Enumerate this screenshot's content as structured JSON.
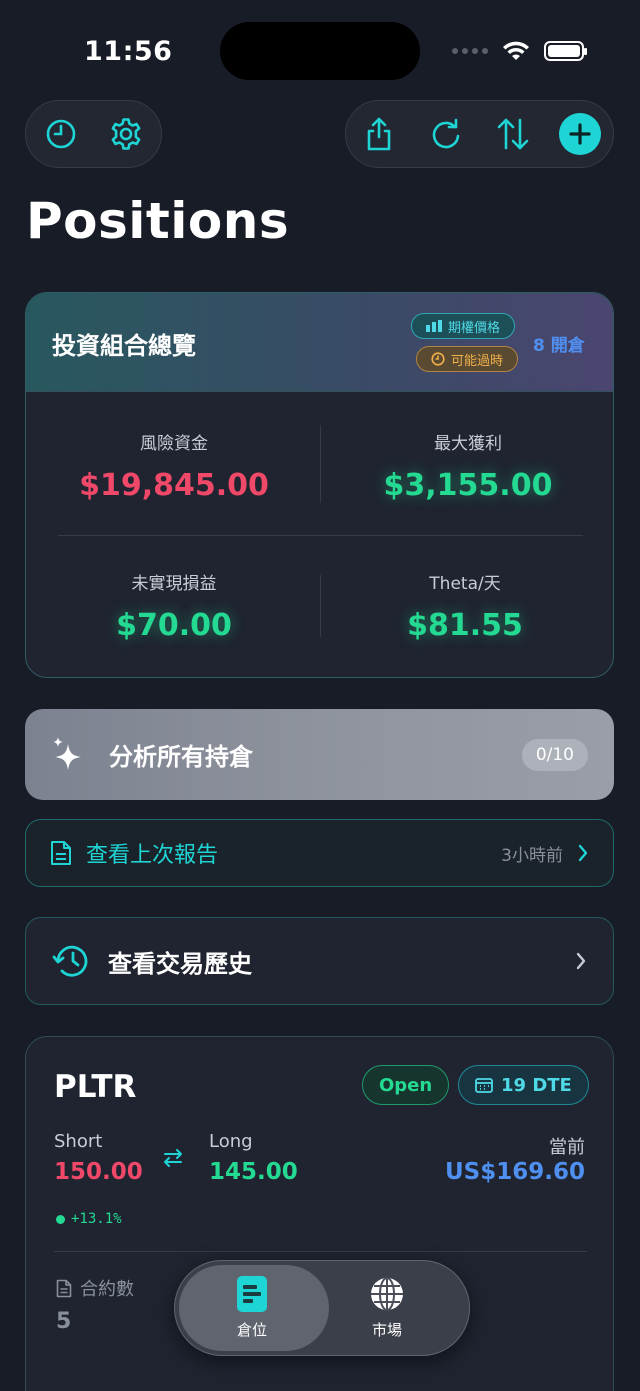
{
  "status_bar": {
    "time": "11:56"
  },
  "page": {
    "title": "Positions"
  },
  "overview": {
    "title": "投資組合總覽",
    "chip_price": "期權價格",
    "chip_expire": "可能過時",
    "open_count": "8 開倉",
    "stats": {
      "capital_at_risk": {
        "label": "風險資金",
        "value": "$19,845.00"
      },
      "max_profit": {
        "label": "最大獲利",
        "value": "$3,155.00"
      },
      "unrealized_pnl": {
        "label": "未實現損益",
        "value": "$70.00"
      },
      "theta_per_day": {
        "label": "Theta/天",
        "value": "$81.55"
      }
    }
  },
  "analyze": {
    "label": "分析所有持倉",
    "count": "0/10"
  },
  "report": {
    "label": "查看上次報告",
    "time": "3小時前"
  },
  "history": {
    "label": "查看交易歷史"
  },
  "position": {
    "ticker": "PLTR",
    "status": "Open",
    "dte": "19 DTE",
    "short_label": "Short",
    "short_value": "150.00",
    "long_label": "Long",
    "long_value": "145.00",
    "current_label": "當前",
    "current_value": "US$169.60",
    "change": "+13.1%",
    "contracts_label": "合約數",
    "contracts_value": "5"
  },
  "tabs": [
    {
      "label": "倉位",
      "icon": "positions-icon",
      "active": true
    },
    {
      "label": "市場",
      "icon": "globe-icon",
      "active": false
    }
  ],
  "colors": {
    "accent": "#1fd4d4",
    "loss": "#f04868",
    "gain": "#24d991",
    "info": "#4f8ff0",
    "warning": "#f0b04a",
    "background": "#181c26"
  }
}
